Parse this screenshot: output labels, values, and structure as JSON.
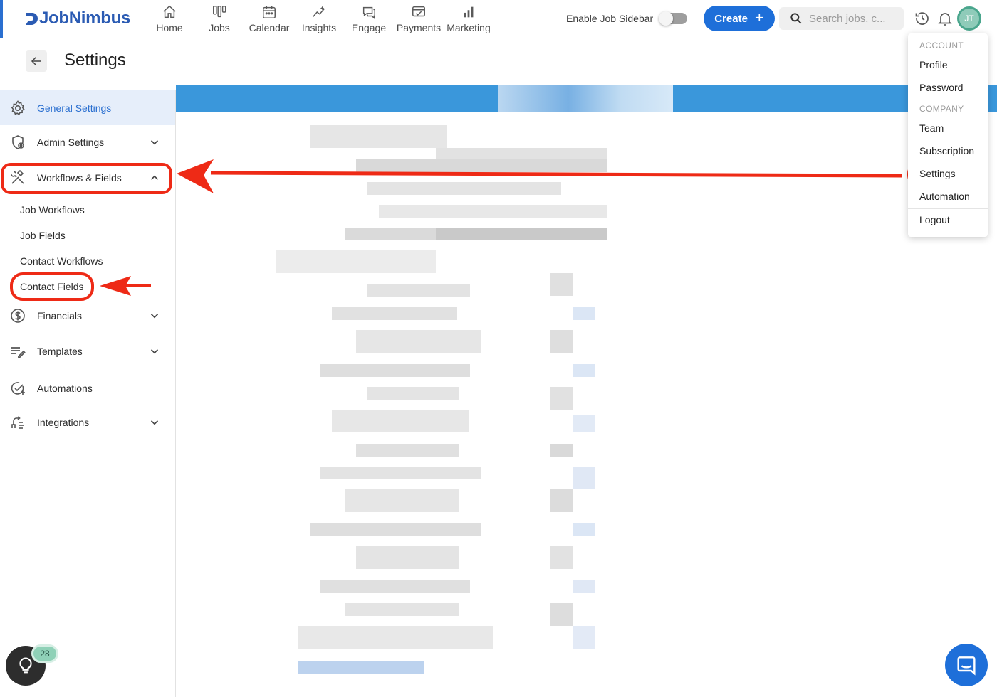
{
  "app": {
    "logo_text": "JobNimbus",
    "brand_color": "#2b5bb3",
    "accent_color": "#1e6fd9"
  },
  "nav": [
    {
      "label": "Home",
      "icon": "home-icon"
    },
    {
      "label": "Jobs",
      "icon": "jobs-board-icon"
    },
    {
      "label": "Calendar",
      "icon": "calendar-icon"
    },
    {
      "label": "Insights",
      "icon": "insights-sparkle-icon"
    },
    {
      "label": "Engage",
      "icon": "chat-bubbles-icon"
    },
    {
      "label": "Payments",
      "icon": "payment-card-icon"
    },
    {
      "label": "Marketing",
      "icon": "bar-chart-icon"
    }
  ],
  "toolbar": {
    "job_sidebar_label": "Enable Job Sidebar",
    "job_sidebar_enabled": false,
    "create_label": "Create",
    "search_placeholder": "Search jobs, c...",
    "avatar_initials": "JT"
  },
  "page": {
    "title": "Settings"
  },
  "sidebar": {
    "items": [
      {
        "label": "General Settings",
        "icon": "gear-icon",
        "active": true,
        "expandable": false
      },
      {
        "label": "Admin Settings",
        "icon": "shield-gear-icon",
        "expandable": true,
        "expanded": false
      },
      {
        "label": "Workflows & Fields",
        "icon": "tools-icon",
        "expandable": true,
        "expanded": true,
        "children": [
          "Job Workflows",
          "Job Fields",
          "Contact Workflows",
          "Contact Fields"
        ]
      },
      {
        "label": "Financials",
        "icon": "dollar-circle-icon",
        "expandable": true,
        "expanded": false
      },
      {
        "label": "Templates",
        "icon": "template-list-icon",
        "expandable": true,
        "expanded": false
      },
      {
        "label": "Automations",
        "icon": "check-plus-icon",
        "expandable": false
      },
      {
        "label": "Integrations",
        "icon": "integrations-icon",
        "expandable": true,
        "expanded": false
      }
    ]
  },
  "account_menu": {
    "account_heading": "ACCOUNT",
    "account_items": [
      "Profile",
      "Password"
    ],
    "company_heading": "COMPANY",
    "company_items": [
      "Team",
      "Subscription",
      "Settings",
      "Automation"
    ],
    "logout_label": "Logout"
  },
  "annotations": {
    "highlight_color": "#ee2a16",
    "highlighted": [
      "Workflows & Fields",
      "Contact Fields",
      "Settings"
    ]
  },
  "help": {
    "badge_count": "28"
  }
}
